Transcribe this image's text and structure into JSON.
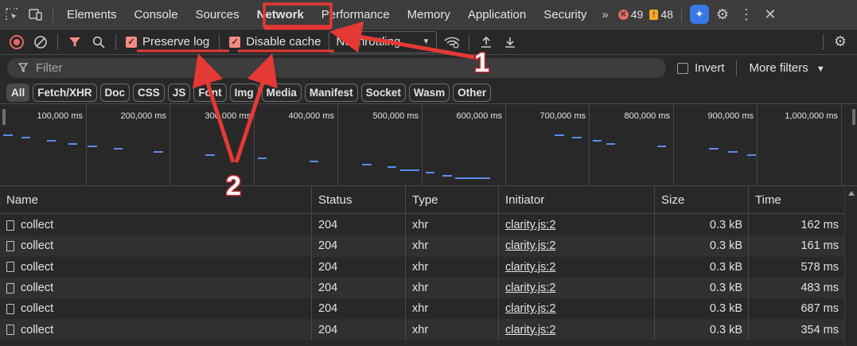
{
  "topbar": {
    "tabs": [
      {
        "label": "Elements"
      },
      {
        "label": "Console"
      },
      {
        "label": "Sources"
      },
      {
        "label": "Network"
      },
      {
        "label": "Performance"
      },
      {
        "label": "Memory"
      },
      {
        "label": "Application"
      },
      {
        "label": "Security"
      }
    ],
    "more_tabs": "»",
    "error_count": "49",
    "warning_count": "48"
  },
  "toolbar": {
    "preserve_log_label": "Preserve log",
    "disable_cache_label": "Disable cache",
    "throttling_value": "No throttling"
  },
  "filter": {
    "placeholder": "Filter",
    "invert_label": "Invert",
    "more_filters_label": "More filters"
  },
  "type_filters": [
    "All",
    "Fetch/XHR",
    "Doc",
    "CSS",
    "JS",
    "Font",
    "Img",
    "Media",
    "Manifest",
    "Socket",
    "Wasm",
    "Other"
  ],
  "overview": {
    "tick_labels": [
      "100,000 ms",
      "200,000 ms",
      "300,000 ms",
      "400,000 ms",
      "500,000 ms",
      "600,000 ms",
      "700,000 ms",
      "800,000 ms",
      "900,000 ms",
      "1,000,000 ms"
    ]
  },
  "table": {
    "columns": [
      "Name",
      "Status",
      "Type",
      "Initiator",
      "Size",
      "Time"
    ],
    "rows": [
      {
        "name": "collect",
        "status": "204",
        "type": "xhr",
        "initiator": "clarity.js:2",
        "size": "0.3 kB",
        "time": "162 ms"
      },
      {
        "name": "collect",
        "status": "204",
        "type": "xhr",
        "initiator": "clarity.js:2",
        "size": "0.3 kB",
        "time": "161 ms"
      },
      {
        "name": "collect",
        "status": "204",
        "type": "xhr",
        "initiator": "clarity.js:2",
        "size": "0.3 kB",
        "time": "578 ms"
      },
      {
        "name": "collect",
        "status": "204",
        "type": "xhr",
        "initiator": "clarity.js:2",
        "size": "0.3 kB",
        "time": "483 ms"
      },
      {
        "name": "collect",
        "status": "204",
        "type": "xhr",
        "initiator": "clarity.js:2",
        "size": "0.3 kB",
        "time": "687 ms"
      },
      {
        "name": "collect",
        "status": "204",
        "type": "xhr",
        "initiator": "clarity.js:2",
        "size": "0.3 kB",
        "time": "354 ms"
      }
    ]
  },
  "annotations": {
    "marker_1": "1",
    "marker_2": "2",
    "color": "#e53935"
  },
  "colors": {
    "accent_red": "#e46962",
    "timeline_bar": "#5b8def",
    "ai_button": "#3b78e7"
  }
}
